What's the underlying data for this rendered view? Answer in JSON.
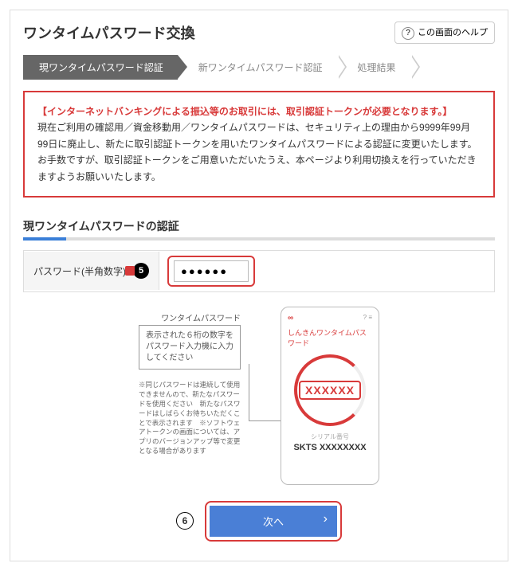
{
  "header": {
    "title": "ワンタイムパスワード交換",
    "help": "この画面のヘルプ"
  },
  "steps": {
    "current": "現ワンタイムパスワード認証",
    "next1": "新ワンタイムパスワード認証",
    "next2": "処理結果"
  },
  "notice": {
    "emphasis": "【インターネットバンキングによる振込等のお取引には、取引認証トークンが必要となります。】",
    "line1": "現在ご利用の確認用／資金移動用／ワンタイムパスワードは、セキュリティ上の理由から9999年99月99日に廃止し、新たに取引認証トークンを用いたワンタイムパスワードによる認証に変更いたします。",
    "line2": "お手数ですが、取引認証トークンをご用意いただいたうえ、本ページより利用切換えを行っていただきますようお願いいたします。"
  },
  "section": {
    "title": "現ワンタイムパスワードの認証"
  },
  "form": {
    "label": "パスワード(半角数字)",
    "badge": "5",
    "value": "●●●●●●"
  },
  "callout": {
    "title": "ワンタイムパスワード",
    "text": "表示された６桁の数字をパスワード入力機に入力してください",
    "notes": "※同じパスワードは連続して使用できませんので、新たなパスワードを使用ください　新たなパスワードはしばらくお待ちいただくことで表示されます　※ソフトウェアトークンの画面については、アプリのバージョンアップ等で変更となる場合があります"
  },
  "phone": {
    "logo": "∞",
    "label": "しんきんワンタイムパスワード",
    "code": "XXXXXX",
    "serial_label": "シリアル番号",
    "serial": "SKTS XXXXXXXX",
    "icon1": "?",
    "icon2": "≡"
  },
  "next": {
    "badge": "6",
    "label": "次へ"
  }
}
